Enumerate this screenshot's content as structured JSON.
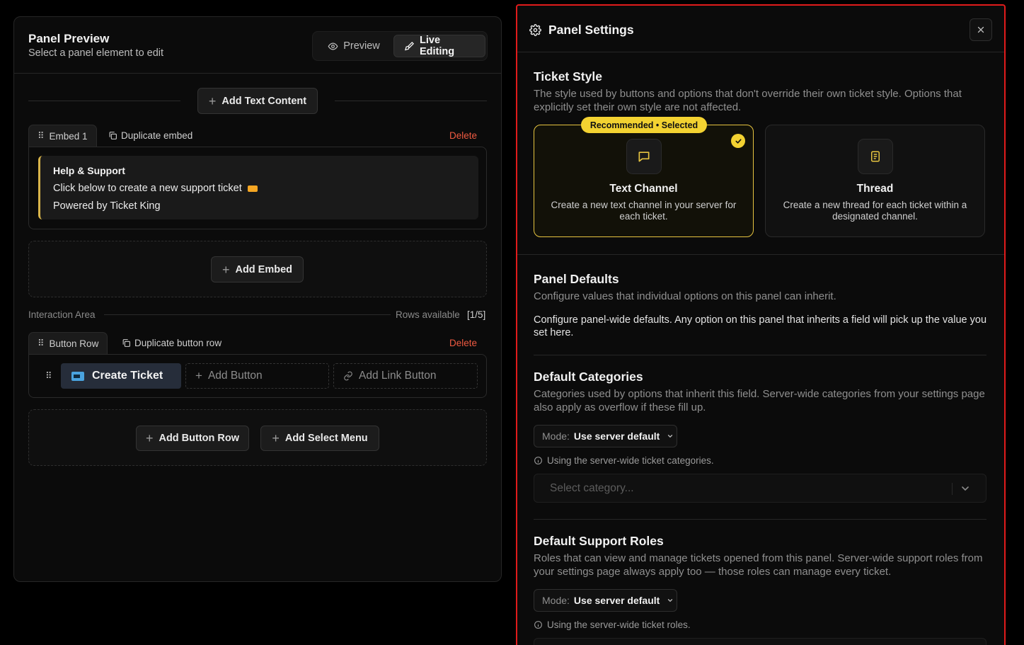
{
  "preview": {
    "title": "Panel Preview",
    "subtitle": "Select a panel element to edit",
    "mode_preview": "Preview",
    "mode_live": "Live Editing",
    "add_text_content": "Add Text Content",
    "embed": {
      "tab_label": "Embed 1",
      "duplicate": "Duplicate embed",
      "delete": "Delete",
      "title": "Help & Support",
      "description": "Click below to create a new support ticket",
      "footer": "Powered by Ticket King"
    },
    "add_embed": "Add Embed",
    "interaction_area": "Interaction Area",
    "rows_available_label": "Rows available",
    "rows_available_value": "[1/5]",
    "button_row": {
      "tab_label": "Button Row",
      "duplicate": "Duplicate button row",
      "delete": "Delete",
      "create_ticket": "Create Ticket",
      "add_button": "Add Button",
      "add_link_button": "Add Link Button"
    },
    "add_button_row": "Add Button Row",
    "add_select_menu": "Add Select Menu"
  },
  "settings": {
    "title": "Panel Settings",
    "ticket_style": {
      "heading": "Ticket Style",
      "description": "The style used by buttons and options that don't override their own ticket style. Options that explicitly set their own style are not affected.",
      "badge": "Recommended • Selected",
      "options": [
        {
          "title": "Text Channel",
          "description": "Create a new text channel in your server for each ticket.",
          "selected": true
        },
        {
          "title": "Thread",
          "description": "Create a new thread for each ticket within a designated channel.",
          "selected": false
        }
      ]
    },
    "panel_defaults": {
      "heading": "Panel Defaults",
      "description": "Configure values that individual options on this panel can inherit.",
      "note": "Configure panel-wide defaults. Any option on this panel that inherits a field will pick up the value you set here."
    },
    "default_categories": {
      "heading": "Default Categories",
      "description": "Categories used by options that inherit this field. Server-wide categories from your settings page also apply as overflow if these fill up.",
      "mode_label": "Mode:",
      "mode_value": "Use server default",
      "info": "Using the server-wide ticket categories.",
      "placeholder": "Select category..."
    },
    "default_support_roles": {
      "heading": "Default Support Roles",
      "description": "Roles that can view and manage tickets opened from this panel. Server-wide support roles from your settings page always apply too — those roles can manage every ticket.",
      "mode_label": "Mode:",
      "mode_value": "Use server default",
      "info": "Using the server-wide ticket roles."
    }
  },
  "colors": {
    "accent": "#f3d231",
    "danger": "#ef5a41",
    "highlight_border": "#e01b1b",
    "embed_bar": "#d9b54a"
  }
}
